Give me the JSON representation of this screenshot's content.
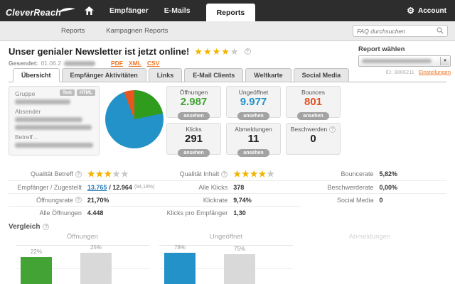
{
  "topnav": {
    "logo": "CleverReach",
    "items": [
      {
        "label": "Empfänger",
        "active": false
      },
      {
        "label": "E-Mails",
        "active": false
      },
      {
        "label": "Reports",
        "active": true
      }
    ],
    "account": {
      "label": "Account"
    }
  },
  "subnav": {
    "items": [
      {
        "label": "Reports"
      },
      {
        "label": "Kampagnen Reports"
      }
    ],
    "search": {
      "placeholder": "FAQ durchsuchen",
      "value": ""
    }
  },
  "report_header": {
    "title": "Unser genialer Newsletter ist jetzt online!",
    "rating": 4,
    "rating_max": 5,
    "sent_label": "Gesendet:",
    "sent_date": "01.06.2",
    "export_links": [
      "PDF",
      "XML",
      "CSV"
    ],
    "picker": {
      "label": "Report wählen",
      "id_text": "ID: 3866211",
      "settings_link": "Einstellungen"
    }
  },
  "tabs": [
    {
      "label": "Übersicht",
      "active": true
    },
    {
      "label": "Empfänger Aktivitäten",
      "active": false
    },
    {
      "label": "Links",
      "active": false
    },
    {
      "label": "E-Mail Clients",
      "active": false
    },
    {
      "label": "Weltkarte",
      "active": false
    },
    {
      "label": "Social Media",
      "active": false
    }
  ],
  "info_card": {
    "badges": [
      "Text",
      "HTML"
    ],
    "fields": [
      {
        "label": "Gruppe",
        "redacted_lines": 1
      },
      {
        "label": "Absender",
        "redacted_lines": 2
      },
      {
        "label": "Betreff...",
        "redacted_lines": 1
      }
    ]
  },
  "stat_boxes": [
    {
      "label": "Öffnungen",
      "value": "2.987",
      "color": "#43a335",
      "action": "ansehen",
      "info": false
    },
    {
      "label": "Ungeöffnet",
      "value": "9.977",
      "color": "#2392c8",
      "action": "ansehen",
      "info": false
    },
    {
      "label": "Bounces",
      "value": "801",
      "color": "#e2511f",
      "action": "ansehen",
      "info": false
    },
    {
      "label": "Klicks",
      "value": "291",
      "color": "#222222",
      "action": "ansehen",
      "info": false
    },
    {
      "label": "Abmeldungen",
      "value": "11",
      "color": "#222222",
      "action": "ansehen",
      "info": false
    },
    {
      "label": "Beschwerden",
      "value": "0",
      "color": "#222222",
      "action": null,
      "info": true
    }
  ],
  "detail_columns": [
    {
      "rows": [
        {
          "label": "Qualität Betreff",
          "info": true,
          "stars": 3
        },
        {
          "label": "Empfänger / Zugestellt",
          "link": "13.765",
          "value": "/ 12.964",
          "note": "(94,18%)"
        },
        {
          "label": "Öffnungsrate",
          "info": true,
          "value": "21,70%"
        },
        {
          "label": "Alle Öffnungen",
          "value": "4.448"
        }
      ]
    },
    {
      "rows": [
        {
          "label": "Qualität Inhalt",
          "info": true,
          "stars": 4
        },
        {
          "label": "Alle Klicks",
          "value": "378"
        },
        {
          "label": "Klickrate",
          "value": "9,74%"
        },
        {
          "label": "Klicks pro Empfänger",
          "value": "1,30"
        }
      ]
    },
    {
      "rows": [
        {
          "label": "Bouncerate",
          "value": "5,82%"
        },
        {
          "label": "Beschwerderate",
          "value": "0,00%"
        },
        {
          "label": "Social Media",
          "value": "0"
        }
      ]
    }
  ],
  "compare": {
    "title": "Vergleich"
  },
  "chart_data": [
    {
      "type": "pie",
      "title": "",
      "segments": [
        {
          "label": "Bounces",
          "value": 801,
          "color": "#e8561f"
        },
        {
          "label": "Öffnungen",
          "value": 2987,
          "color": "#2f9c1e"
        },
        {
          "label": "Ungeöffnet",
          "value": 9977,
          "color": "#2392c8"
        }
      ]
    },
    {
      "type": "bar",
      "title": "Öffnungen",
      "values": [
        22,
        25
      ],
      "labels": [
        "22%",
        "25%"
      ],
      "colors": [
        "#43a335",
        "#d9d9d9"
      ],
      "faded": false
    },
    {
      "type": "bar",
      "title": "Ungeöffnet",
      "values": [
        78,
        75
      ],
      "labels": [
        "78%",
        "75%"
      ],
      "colors": [
        "#2392c8",
        "#d9d9d9"
      ],
      "faded": false
    },
    {
      "type": "bar",
      "title": "Abmeldungen",
      "values": [],
      "labels": [],
      "colors": [],
      "faded": true
    }
  ]
}
